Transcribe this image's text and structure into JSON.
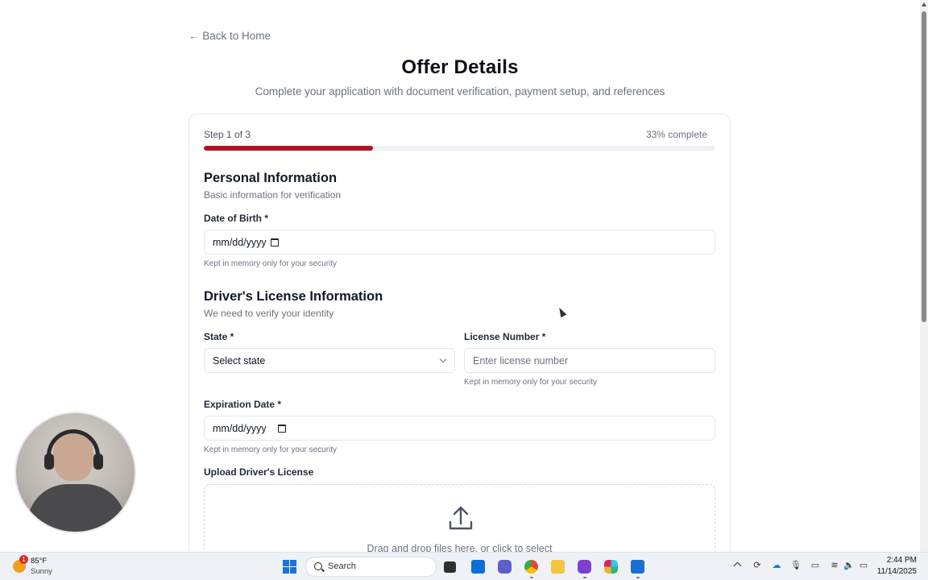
{
  "page": {
    "back_link": "← Back to Home",
    "title": "Offer Details",
    "subtitle": "Complete your application with document verification, payment setup, and references"
  },
  "progress": {
    "step_label": "Step 1 of 3",
    "percent_label": "33% complete",
    "fraction": 0.33
  },
  "personal": {
    "title": "Personal Information",
    "subtitle": "Basic information for verification",
    "dob_label": "Date of Birth *",
    "dob_value": "mm/dd/yyyy",
    "dob_hint": "Kept in memory only for your security"
  },
  "license": {
    "title": "Driver's License Information",
    "subtitle": "We need to verify your identity",
    "state_label": "State *",
    "state_value": "Select state",
    "number_label": "License Number *",
    "number_placeholder": "Enter license number",
    "number_hint": "Kept in memory only for your security",
    "exp_label": "Expiration Date *",
    "exp_value": "mm/dd/yyyy",
    "exp_hint": "Kept in memory only for your security",
    "upload_label": "Upload Driver's License",
    "upload_text": "Drag and drop files here, or click to select"
  },
  "taskbar": {
    "weather_badge": "1",
    "weather_temp": "85°F",
    "weather_cond": "Sunny",
    "search_label": "Search",
    "apps": [
      "file-explorer-app-icon",
      "terminal-app-icon",
      "store-app-icon",
      "teams-app-icon",
      "chrome-app-icon",
      "folder-app-icon",
      "video-app-icon",
      "slack-app-icon",
      "outlook-app-icon"
    ],
    "time": "2:44 PM",
    "date": "11/14/2025"
  },
  "colors": {
    "accent": "#b01226",
    "windows_blue": "#1a73d9"
  }
}
